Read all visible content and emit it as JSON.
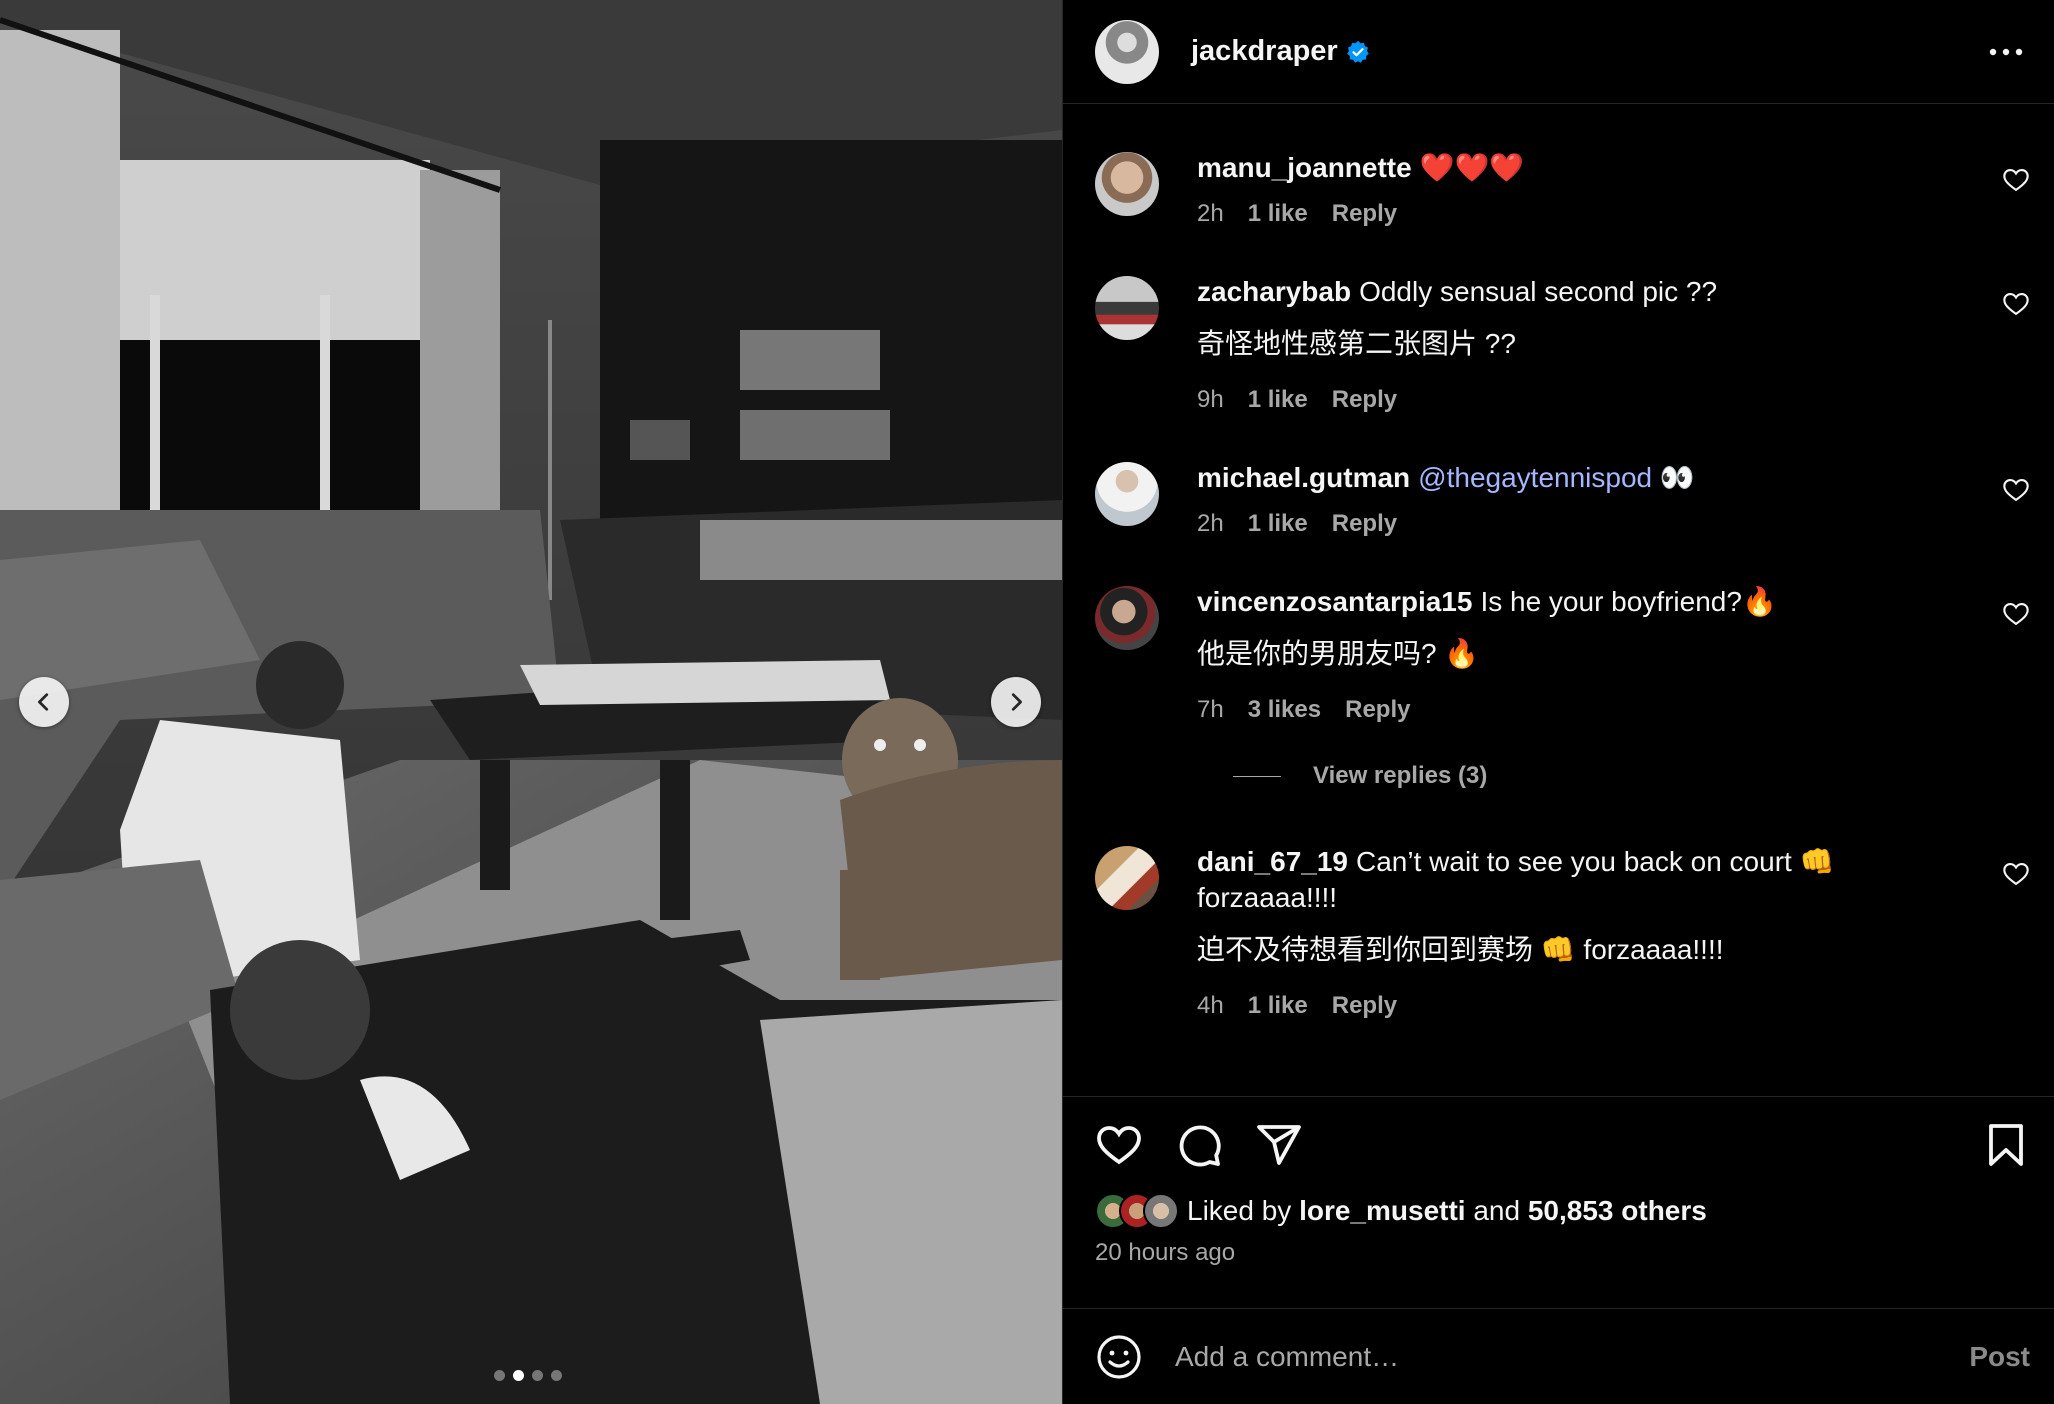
{
  "post": {
    "author": "jackdraper",
    "carousel": {
      "total": 4,
      "active_index": 1
    }
  },
  "comments": [
    {
      "username": "manu_joannette",
      "text": "❤️❤️❤️",
      "time": "2h",
      "likes": "1 like",
      "reply": "Reply"
    },
    {
      "username": "zacharybab",
      "text": "Oddly sensual second pic ??",
      "translation": "奇怪地性感第二张图片 ??",
      "time": "9h",
      "likes": "1 like",
      "reply": "Reply"
    },
    {
      "username": "michael.gutman",
      "mention": "@thegaytennispod",
      "text": "👀",
      "time": "2h",
      "likes": "1 like",
      "reply": "Reply"
    },
    {
      "username": "vincenzosantarpia15",
      "text": "Is he your boyfriend?🔥",
      "translation": "他是你的男朋友吗? 🔥",
      "time": "7h",
      "likes": "3 likes",
      "reply": "Reply",
      "view_replies": "View replies (3)"
    },
    {
      "username": "dani_67_19",
      "text": "Can’t wait to see you back on court 👊 forzaaaa!!!!",
      "translation": "迫不及待想看到你回到赛场 👊 forzaaaa!!!!",
      "time": "4h",
      "likes": "1 like",
      "reply": "Reply"
    }
  ],
  "likes": {
    "prefix": "Liked by",
    "user": "lore_musetti",
    "joiner": "and",
    "others": "50,853 others"
  },
  "time_ago": "20 hours ago",
  "composer": {
    "placeholder": "Add a comment…",
    "post_label": "Post"
  },
  "colors": {
    "background": "#000000",
    "text": "#f5f5f5",
    "muted": "#a8a8a8",
    "mention": "#a6b6ff",
    "verified": "#0095f6"
  },
  "icons": [
    "chevron-left-icon",
    "chevron-right-icon",
    "verified-badge-icon",
    "more-icon",
    "heart-icon",
    "comment-icon",
    "share-icon",
    "bookmark-icon",
    "emoji-icon"
  ]
}
